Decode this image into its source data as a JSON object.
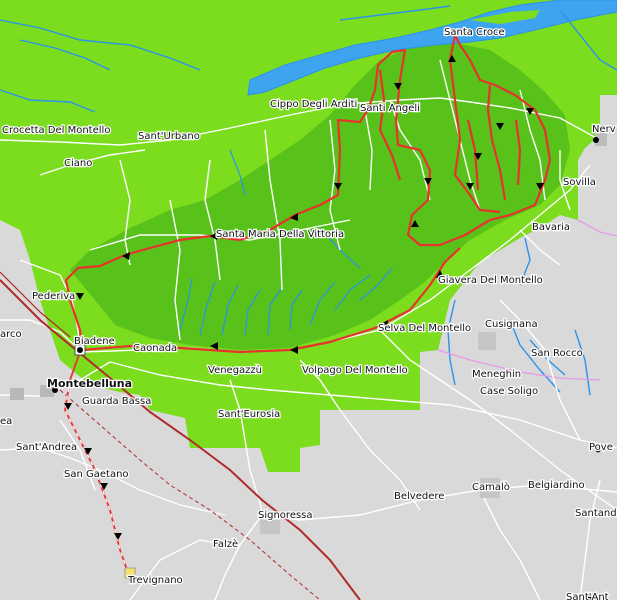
{
  "map": {
    "colors": {
      "land": "#d9d9d9",
      "plain_green": "#7cdc1e",
      "montello_green": "#58c21a",
      "water_blue": "#2a93ea",
      "river_fill": "#3fa4f0",
      "road_white": "#ffffff",
      "rail": "#b02a2a",
      "route_red": "#e8322d",
      "boundary_pink": "#e79ae7"
    },
    "places": [
      {
        "id": "santa-croce",
        "name": "Santa Croce"
      },
      {
        "id": "santi-angeli",
        "name": "Santi Angeli"
      },
      {
        "id": "cippo-degli-arditi",
        "name": "Cippo Degli Arditi"
      },
      {
        "id": "crocetta-del-montello",
        "name": "Crocetta Del Montello"
      },
      {
        "id": "sant-urbano",
        "name": "Sant'Urbano"
      },
      {
        "id": "ciano",
        "name": "Ciano"
      },
      {
        "id": "nervesa",
        "name": "Nerv"
      },
      {
        "id": "sovilla",
        "name": "Sovilla"
      },
      {
        "id": "bavaria",
        "name": "Bavaria"
      },
      {
        "id": "santa-maria-della-vittoria",
        "name": "Santa Maria Della Vittoria"
      },
      {
        "id": "giavera-del-montello",
        "name": "Giavera Del Montello"
      },
      {
        "id": "pederiva",
        "name": "Pederiva"
      },
      {
        "id": "biadene",
        "name": "Biadene"
      },
      {
        "id": "caonada",
        "name": "Caonada"
      },
      {
        "id": "selva-del-montello",
        "name": "Selva Del Montello"
      },
      {
        "id": "cusignana",
        "name": "Cusignana"
      },
      {
        "id": "san-rocco",
        "name": "San Rocco"
      },
      {
        "id": "marco",
        "name": "arco"
      },
      {
        "id": "montebelluna",
        "name": "Montebelluna"
      },
      {
        "id": "guarda-bassa",
        "name": "Guarda Bassa"
      },
      {
        "id": "venegazzu",
        "name": "Venegazzù"
      },
      {
        "id": "volpago-del-montello",
        "name": "Volpago Del Montello"
      },
      {
        "id": "meneghin",
        "name": "Meneghin"
      },
      {
        "id": "case-soligo",
        "name": "Case Soligo"
      },
      {
        "id": "sant-eurosia",
        "name": "Sant'Eurosia"
      },
      {
        "id": "sant-andrea",
        "name": "Sant'Andrea"
      },
      {
        "id": "ea",
        "name": "ea"
      },
      {
        "id": "pove",
        "name": "Pove"
      },
      {
        "id": "san-gaetano",
        "name": "San Gaetano"
      },
      {
        "id": "belvedere",
        "name": "Belvedere"
      },
      {
        "id": "camalo",
        "name": "Camalò"
      },
      {
        "id": "belgiardino",
        "name": "Belgiardino"
      },
      {
        "id": "signoressa",
        "name": "Signoressa"
      },
      {
        "id": "santand",
        "name": "Santand"
      },
      {
        "id": "falze",
        "name": "Falzè"
      },
      {
        "id": "trevignano",
        "name": "Trevignano"
      },
      {
        "id": "santantonio",
        "name": "Sant'Ant"
      }
    ]
  }
}
